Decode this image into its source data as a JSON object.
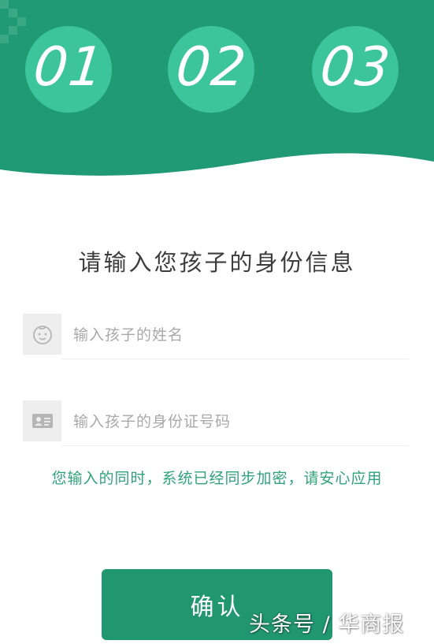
{
  "steps": [
    {
      "number": "01"
    },
    {
      "number": "02"
    },
    {
      "number": "03"
    }
  ],
  "form": {
    "title": "请输入您孩子的身份信息",
    "name_field": {
      "placeholder": "输入孩子的姓名",
      "icon": "child-face-icon"
    },
    "id_field": {
      "placeholder": "输入孩子的身份证号码",
      "icon": "id-card-icon"
    },
    "notice": "您输入的同时，系统已经同步加密，请安心应用",
    "confirm_label": "确认"
  },
  "watermark": "头条号 / 华商报",
  "colors": {
    "header_green": "#1f9a72",
    "step_circle": "#3cc49a",
    "notice_text": "#2fa37a",
    "button_green": "#219770"
  }
}
